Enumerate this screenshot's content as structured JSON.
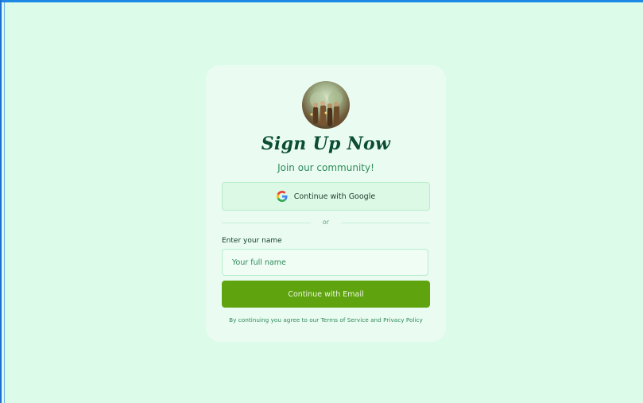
{
  "signup": {
    "title": "Sign Up Now",
    "subtitle": "Join our community!",
    "google_button": "Continue with Google",
    "divider_text": "or",
    "name_label": "Enter your name",
    "name_placeholder": "Your full name",
    "email_button": "Continue with Email",
    "legal_prefix": "By continuing you agree to our ",
    "terms_link": "Terms of Service",
    "legal_and": " and ",
    "privacy_link": "Privacy Policy"
  },
  "icons": {
    "google": "google-g-icon",
    "avatar": "community-photo-avatar"
  },
  "colors": {
    "background": "#dcfbe8",
    "card": "#eafcf1",
    "title": "#0b4d35",
    "accent_text": "#2f8a5a",
    "primary_button": "#5fa30f"
  }
}
